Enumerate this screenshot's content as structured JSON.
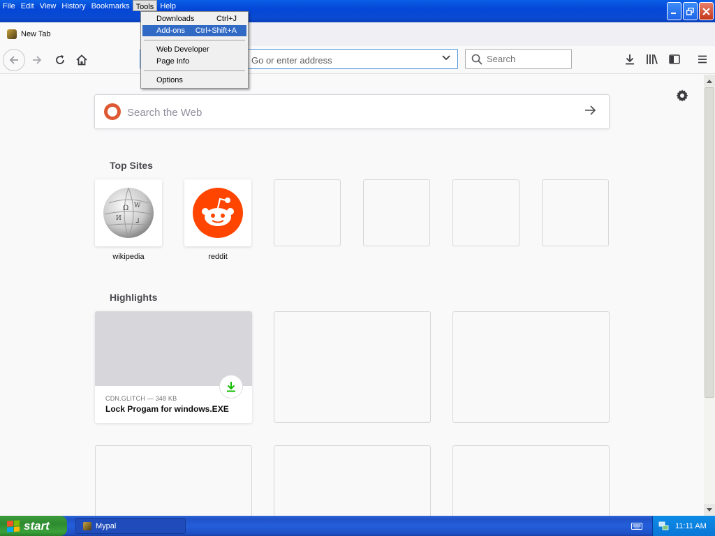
{
  "menubar": {
    "items": [
      {
        "label": "File",
        "active": false
      },
      {
        "label": "Edit",
        "active": false
      },
      {
        "label": "View",
        "active": false
      },
      {
        "label": "History",
        "active": false
      },
      {
        "label": "Bookmarks",
        "active": false
      },
      {
        "label": "Tools",
        "active": true
      },
      {
        "label": "Help",
        "active": false
      }
    ]
  },
  "tools_menu": {
    "downloads": {
      "label": "Downloads",
      "shortcut": "Ctrl+J"
    },
    "addons": {
      "label": "Add-ons",
      "shortcut": "Ctrl+Shift+A",
      "highlighted": true
    },
    "web_developer": {
      "label": "Web Developer"
    },
    "page_info": {
      "label": "Page Info"
    },
    "options": {
      "label": "Options"
    }
  },
  "tab": {
    "title": "New Tab",
    "icon": "mypal-icon"
  },
  "navbar": {
    "url_placeholder": "Go or enter address",
    "search_placeholder": "Search"
  },
  "newtab": {
    "web_search_placeholder": "Search the Web",
    "top_sites_title": "Top Sites",
    "top_sites": [
      {
        "label": "wikipedia",
        "icon": "wikipedia-globe-icon"
      },
      {
        "label": "reddit",
        "icon": "reddit-icon"
      }
    ],
    "highlights_title": "Highlights",
    "highlight": {
      "meta": "CDN.GLITCH — 348 KB",
      "title": "Lock Progam for windows.EXE"
    }
  },
  "taskbar": {
    "start_label": "start",
    "task_label": "Mypal",
    "clock": "11:11 AM"
  },
  "colors": {
    "titlebar": "#0a5fe6",
    "menu_highlight": "#316ac5",
    "accent": "#4a90d9",
    "reddit": "#ff4500",
    "download_green": "#12bc00"
  }
}
